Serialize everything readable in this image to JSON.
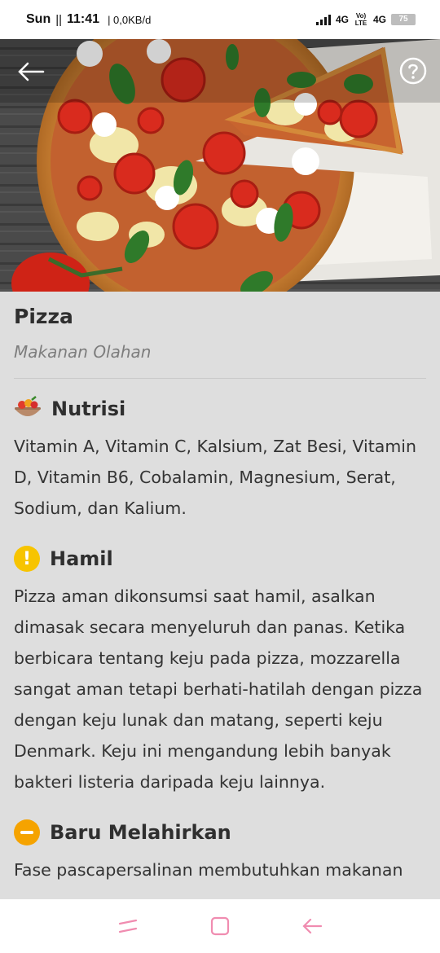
{
  "status_bar": {
    "day": "Sun",
    "separator": "||",
    "time": "11:41",
    "net_speed": "| 0,0KB/d",
    "net_type_1": "4G",
    "net_type_2": "4G",
    "volte": "Vo) LTE",
    "battery": "75"
  },
  "header": {
    "back_icon": "arrow-left-icon",
    "help_icon": "help-circle-icon"
  },
  "food": {
    "name": "Pizza",
    "category": "Makanan Olahan"
  },
  "sections": [
    {
      "title": "Nutrisi",
      "icon": "food-bowl-icon",
      "body": "Vitamin A, Vitamin C, Kalsium, Zat Besi, Vitamin D, Vitamin B6, Cobalamin, Magnesium, Serat, Sodium, dan Kalium."
    },
    {
      "title": "Hamil",
      "icon": "warning-exclamation-icon",
      "icon_color": "#f7c400",
      "body": "Pizza aman dikonsumsi saat hamil, asalkan dimasak secara menyeluruh dan panas. Ketika berbicara tentang keju pada pizza, mozzarella sangat aman tetapi berhati-hatilah dengan pizza dengan keju lunak dan matang, seperti keju Denmark. Keju ini mengandung lebih banyak bakteri listeria daripada keju lainnya."
    },
    {
      "title": "Baru Melahirkan",
      "icon": "minus-circle-icon",
      "icon_color": "#f5a300",
      "body": "Fase pascapersalinan membutuhkan makanan"
    }
  ],
  "nav": {
    "recent_icon": "recent-apps-icon",
    "home_icon": "home-square-icon",
    "back_icon": "back-arrow-icon",
    "accent": "#f08cb0"
  }
}
